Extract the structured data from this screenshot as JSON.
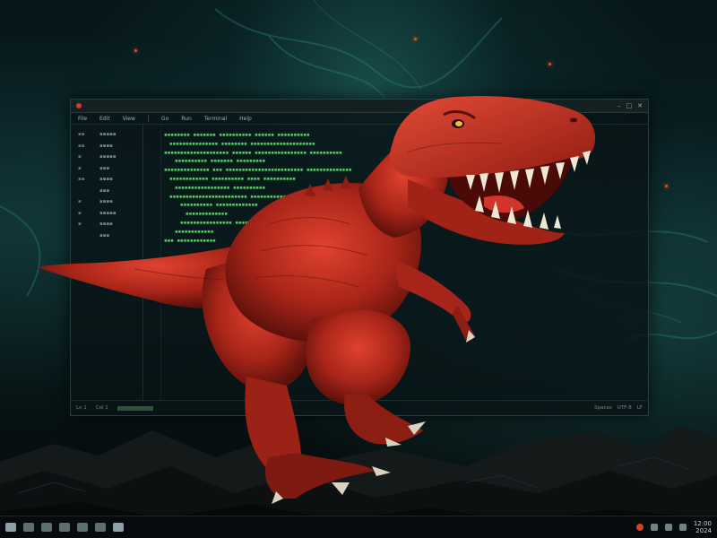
{
  "window": {
    "menu": [
      "File",
      "Edit",
      "View",
      "Go",
      "Run",
      "Terminal",
      "Help"
    ],
    "status_left": [
      "Ln 1",
      "Col 1"
    ],
    "status_right": [
      "Spaces",
      "UTF-8",
      "LF"
    ]
  },
  "taskbar": {
    "clock_time": "12:00",
    "clock_date": "2024"
  },
  "colors": {
    "accent_red": "#d23c2a",
    "code_green": "#5fdc6a",
    "teal_smoke": "#2f8c82"
  },
  "icons": {
    "window_close": "close-icon",
    "window_minimize": "minimize-icon",
    "window_maximize": "maximize-icon"
  }
}
